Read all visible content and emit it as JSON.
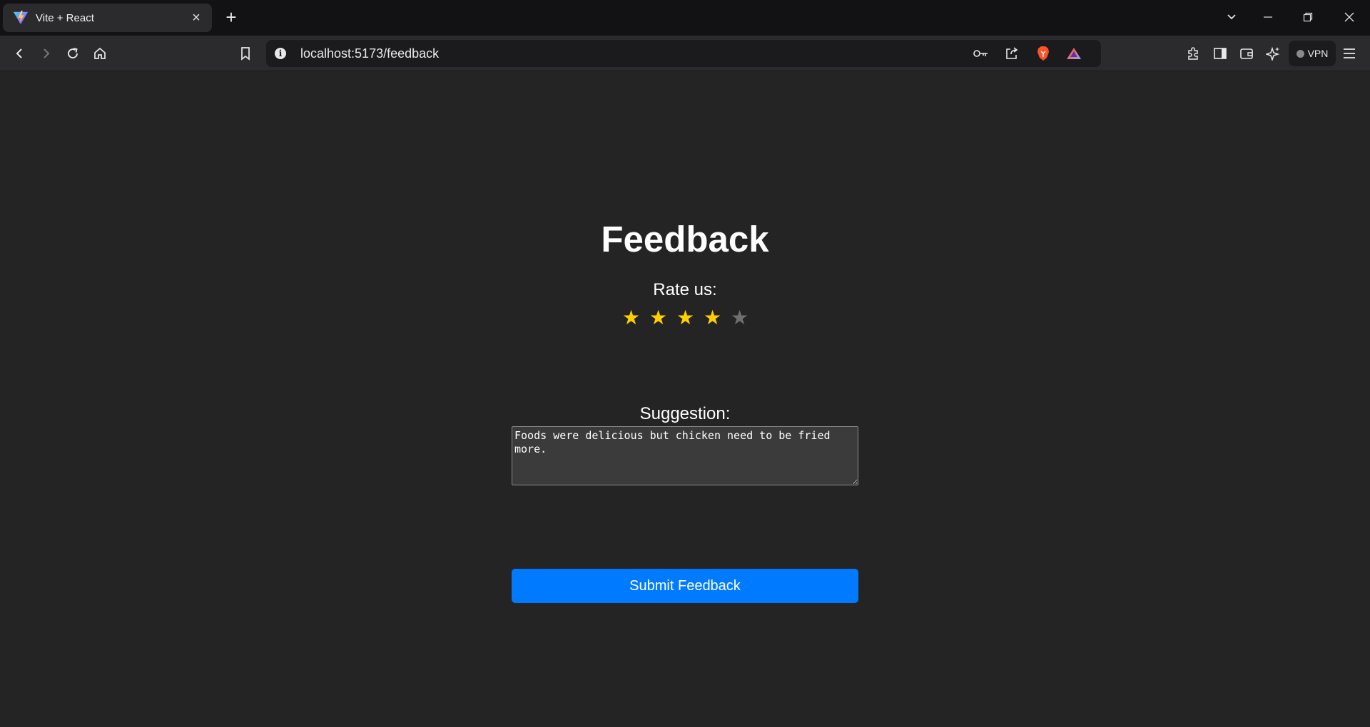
{
  "browser": {
    "tab": {
      "title": "Vite + React",
      "favicon": "vite-logo-icon",
      "close": "×"
    },
    "new_tab": "+",
    "url": "localhost:5173/feedback",
    "vpn_label": "VPN"
  },
  "page": {
    "title": "Feedback",
    "rate_label": "Rate us:",
    "rating": {
      "value": 4,
      "max": 5,
      "star_glyph": "★"
    },
    "suggestion_label": "Suggestion:",
    "suggestion_text": "Foods were delicious but chicken need to be fried more.",
    "submit_label": "Submit Feedback"
  },
  "colors": {
    "page_bg": "#242424",
    "star_on": "#ffd000",
    "star_off": "#6f6f6f",
    "submit_bg": "#007bff"
  }
}
